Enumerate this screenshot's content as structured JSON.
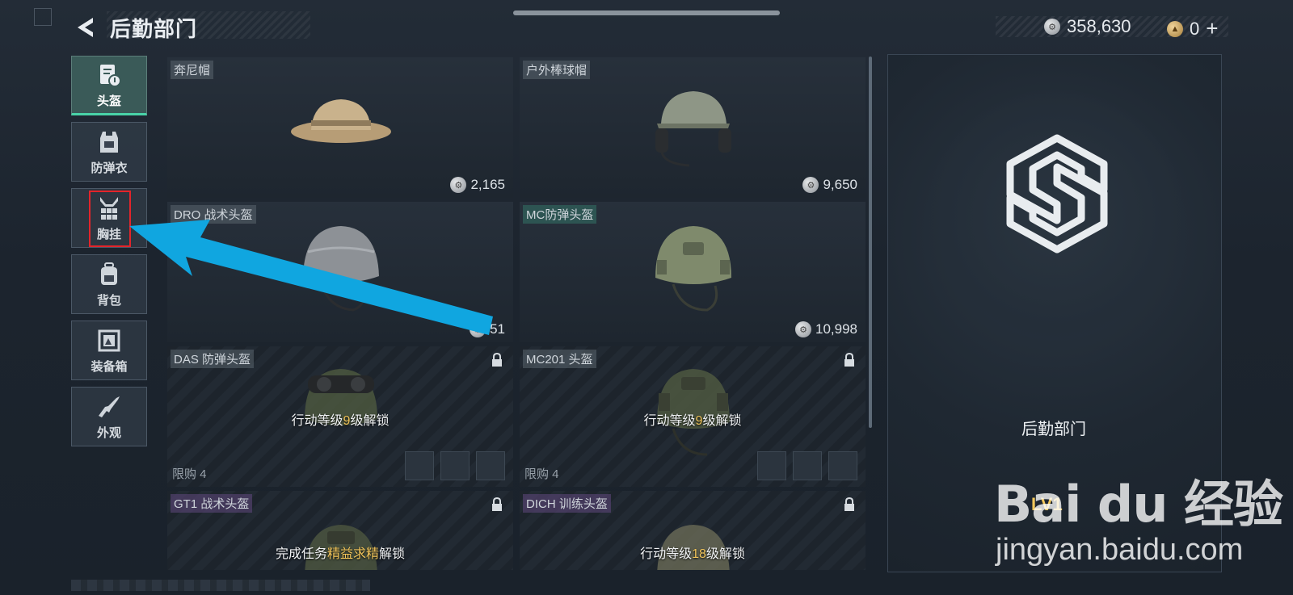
{
  "header": {
    "title": "后勤部门"
  },
  "currency": {
    "silver_amount": "358,630",
    "gold_amount": "0",
    "add_symbol": "+"
  },
  "sidebar": {
    "items": [
      {
        "label": "头盔",
        "icon": "helmet-doc-icon",
        "active": true
      },
      {
        "label": "防弹衣",
        "icon": "vest-icon"
      },
      {
        "label": "胸挂",
        "icon": "chest-rig-icon"
      },
      {
        "label": "背包",
        "icon": "backpack-icon"
      },
      {
        "label": "装备箱",
        "icon": "gear-box-icon"
      },
      {
        "label": "外观",
        "icon": "rifle-icon"
      }
    ]
  },
  "items": [
    {
      "name": "奔尼帽",
      "price": "2,165"
    },
    {
      "name": "户外棒球帽",
      "price": "9,650"
    },
    {
      "name": "DRO 战术头盔",
      "price": "51"
    },
    {
      "name": "MC防弹头盔",
      "price": "10,998"
    },
    {
      "name": "DAS 防弹头盔",
      "unlock_pre": "行动等级",
      "unlock_accent": "9",
      "unlock_post": "级解锁",
      "limit": "限购 4"
    },
    {
      "name": "MC201 头盔",
      "unlock_pre": "行动等级",
      "unlock_accent": "9",
      "unlock_post": "级解锁",
      "limit": "限购 4"
    },
    {
      "name": "GT1 战术头盔",
      "unlock_pre": "完成任务",
      "unlock_accent": "精益求精",
      "unlock_post": "解锁"
    },
    {
      "name": "DICH 训练头盔",
      "unlock_pre": "行动等级",
      "unlock_accent": "18",
      "unlock_post": "级解锁"
    }
  ],
  "right_panel": {
    "department_name": "后勤部门",
    "level": "LV1"
  },
  "watermark": {
    "logo_text": "Bai du 经验",
    "url": "jingyan.baidu.com"
  },
  "colors": {
    "highlight_box": "#e4242a",
    "arrow": "#10a6e0",
    "active_tab": "#49d3a8",
    "unlock_accent": "#f1c45a"
  }
}
